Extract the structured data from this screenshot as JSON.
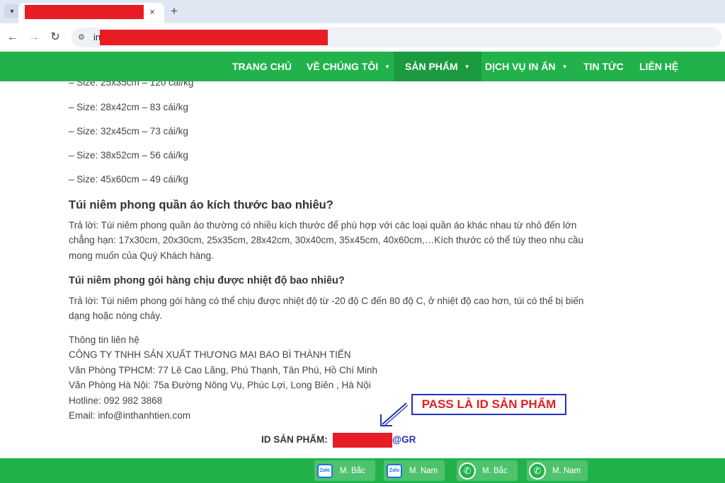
{
  "browser": {
    "tab_close": "×",
    "new_tab": "+",
    "url_prefix": "in",
    "icons": {
      "tab_list": "chevron-down-icon",
      "back": "back-arrow-icon",
      "forward": "forward-arrow-icon",
      "reload": "reload-icon",
      "site": "site-info-icon"
    }
  },
  "nav": {
    "items": [
      {
        "label": "TRANG CHỦ",
        "dropdown": false
      },
      {
        "label": "VỀ CHÚNG TÔI",
        "dropdown": true
      },
      {
        "label": "SẢN PHẨM",
        "dropdown": true,
        "active": true
      },
      {
        "label": "DỊCH VỤ IN ẤN",
        "dropdown": true
      },
      {
        "label": "TIN TỨC",
        "dropdown": false
      },
      {
        "label": "LIÊN HỆ",
        "dropdown": false
      }
    ],
    "bg_color": "#22b24c",
    "active_color": "#1c9a40"
  },
  "sizes": [
    "– Size: 25x35cm – 120 cái/kg",
    "– Size: 28x42cm – 83 cái/kg",
    "– Size: 32x45cm – 73 cái/kg",
    "– Size: 38x52cm – 56 cái/kg",
    "– Size: 45x60cm –  49 cái/kg"
  ],
  "faq": [
    {
      "question": "Túi niêm phong quần áo kích thước bao nhiêu?",
      "answer_lines": [
        "Trả lời: Túi niêm phong quần áo thường có nhiều kích thước để phù hợp với các loại quần áo khác nhau từ nhỏ đến lớn",
        "chẳng hạn: 17x30cm, 20x30cm, 25x35cm, 28x42cm, 30x40cm, 35x45cm, 40x60cm,…Kích thước có thể tùy theo nhu cầu",
        "mong muốn của Quý Khách hàng."
      ]
    },
    {
      "question": "Túi niêm phong gói hàng chịu được nhiệt độ bao nhiêu?",
      "answer_lines": [
        "Trả lời: Túi niêm phong gói hàng có thể chịu được nhiệt độ từ -20 độ C đến 80 độ C, ở nhiệt độ cao hơn, túi có thể bị biến",
        "dạng hoặc nóng chảy."
      ]
    }
  ],
  "contact": {
    "heading": "Thông tin liên hệ",
    "company": "CÔNG TY TNHH SẢN XUẤT THƯƠNG MẠI BAO BÌ THÀNH TIẾN",
    "office_hcm": "Văn Phòng TPHCM: 77 Lê Cao Lãng, Phú Thạnh, Tân Phú, Hồ Chí Minh",
    "office_hn": "Văn Phòng Hà Nội: 75a Đường Nông Vụ, Phúc Lợi, Long Biên , Hà Nội",
    "hotline": "Hotline: 092 982 3868",
    "email": "Email: info@inthanhtien.com"
  },
  "annotation": {
    "callout": "PASS LÀ ID SẢN PHẨM",
    "callout_color": "#e02020",
    "border_color": "#2233bb"
  },
  "product_id": {
    "label": "ID SẢN PHẨM: ",
    "suffix": "@GR",
    "redact_color": "#e81c24"
  },
  "footer": {
    "buttons": [
      {
        "icon": "zalo-icon",
        "icon_text": "Zalo",
        "label": "M. Bắc"
      },
      {
        "icon": "zalo-icon",
        "icon_text": "Zalo",
        "label": "M. Nam"
      },
      {
        "icon": "phone-icon",
        "label": "M. Bắc"
      },
      {
        "icon": "phone-icon",
        "label": "M. Nam"
      }
    ]
  }
}
